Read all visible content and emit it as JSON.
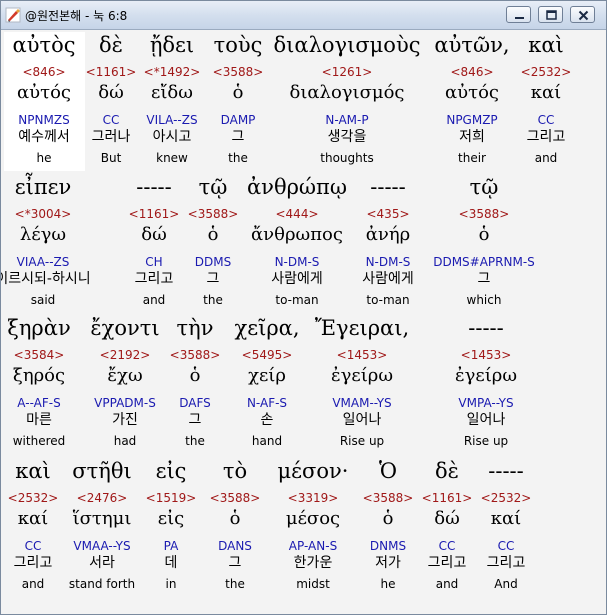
{
  "window": {
    "title": "@원전본해 - 눅 6:8",
    "icon": "pen-icon"
  },
  "rows": [
    [
      {
        "greek": "αὐτὸς",
        "strong": "<846>",
        "lemma": "αὐτός",
        "morph": "NPNMZS",
        "korean": "예수께서",
        "english": "he"
      },
      {
        "greek": "δὲ",
        "strong": "<1161>",
        "lemma": "δώ",
        "morph": "CC",
        "korean": "그러나",
        "english": "But"
      },
      {
        "greek": "ᾔδει",
        "strong": "<*1492>",
        "lemma": "εἴδω",
        "morph": "VILA--ZS",
        "korean": "아시고",
        "english": "knew"
      },
      {
        "greek": "τοὺς",
        "strong": "<3588>",
        "lemma": "ὁ",
        "morph": "DAMP",
        "korean": "그",
        "english": "the"
      },
      {
        "greek": "διαλογισμοὺς",
        "strong": "<1261>",
        "lemma": "διαλογισμός",
        "morph": "N-AM-P",
        "korean": "생각을",
        "english": "thoughts"
      },
      {
        "greek": "αὐτῶν,",
        "strong": "<846>",
        "lemma": "αὐτός",
        "morph": "NPGMZP",
        "korean": "저희",
        "english": "their"
      },
      {
        "greek": "καὶ",
        "strong": "<2532>",
        "lemma": "καί",
        "morph": "CC",
        "korean": "그리고",
        "english": "and"
      }
    ],
    [
      {
        "greek": "εἶπεν",
        "strong": "<*3004>",
        "lemma": "λέγω",
        "morph": "VIAA--ZS",
        "korean": "이르시되-하시니",
        "english": "said"
      },
      {
        "greek": "-----",
        "strong": "<1161>",
        "lemma": "δώ",
        "morph": "CH",
        "korean": "그리고",
        "english": "and"
      },
      {
        "greek": "τῷ",
        "strong": "<3588>",
        "lemma": "ὁ",
        "morph": "DDMS",
        "korean": "그",
        "english": "the"
      },
      {
        "greek": "ἀνθρώπῳ",
        "strong": "<444>",
        "lemma": "ἄνθρωπος",
        "morph": "N-DM-S",
        "korean": "사람에게",
        "english": "to-man"
      },
      {
        "greek": "-----",
        "strong": "<435>",
        "lemma": "ἀνήρ",
        "morph": "N-DM-S",
        "korean": "사람에게",
        "english": "to-man"
      },
      {
        "greek": "τῷ",
        "strong": "<3588>",
        "lemma": "ὁ",
        "morph": "DDMS#APRNM-S",
        "korean": "그",
        "english": "which"
      }
    ],
    [
      {
        "greek": "ξηρὰν",
        "strong": "<3584>",
        "lemma": "ξηρός",
        "morph": "A--AF-S",
        "korean": "마른",
        "english": "withered"
      },
      {
        "greek": "ἔχοντι",
        "strong": "<2192>",
        "lemma": "ἔχω",
        "morph": "VPPADM-S",
        "korean": "가진",
        "english": "had"
      },
      {
        "greek": "τὴν",
        "strong": "<3588>",
        "lemma": "ὁ",
        "morph": "DAFS",
        "korean": "그",
        "english": "the"
      },
      {
        "greek": "χεῖρα,",
        "strong": "<5495>",
        "lemma": "χείρ",
        "morph": "N-AF-S",
        "korean": "손",
        "english": "hand"
      },
      {
        "greek": "Ἔγειραι,",
        "strong": "<1453>",
        "lemma": "ἐγείρω",
        "morph": "VMAM--YS",
        "korean": "일어나",
        "english": "Rise up"
      },
      {
        "greek": "-----",
        "strong": "<1453>",
        "lemma": "ἐγείρω",
        "morph": "VMPA--YS",
        "korean": "일어나",
        "english": "Rise up"
      }
    ],
    [
      {
        "greek": "καὶ",
        "strong": "<2532>",
        "lemma": "καί",
        "morph": "CC",
        "korean": "그리고",
        "english": "and"
      },
      {
        "greek": "στῆθι",
        "strong": "<2476>",
        "lemma": "ἵστημι",
        "morph": "VMAA--YS",
        "korean": "서라",
        "english": "stand forth"
      },
      {
        "greek": "εἰς",
        "strong": "<1519>",
        "lemma": "εἰς",
        "morph": "PA",
        "korean": "데",
        "english": "in"
      },
      {
        "greek": "τὸ",
        "strong": "<3588>",
        "lemma": "ὁ",
        "morph": "DANS",
        "korean": "그",
        "english": "the"
      },
      {
        "greek": "μέσον·",
        "strong": "<3319>",
        "lemma": "μέσος",
        "morph": "AP-AN-S",
        "korean": "한가운",
        "english": "midst"
      },
      {
        "greek": "Ὁ",
        "strong": "<3588>",
        "lemma": "ὁ",
        "morph": "DNMS",
        "korean": "저가",
        "english": "he"
      },
      {
        "greek": "δὲ",
        "strong": "<1161>",
        "lemma": "δώ",
        "morph": "CC",
        "korean": "그리고",
        "english": "and"
      },
      {
        "greek": "-----",
        "strong": "<2532>",
        "lemma": "καί",
        "morph": "CC",
        "korean": "그리고",
        "english": "And"
      }
    ]
  ]
}
